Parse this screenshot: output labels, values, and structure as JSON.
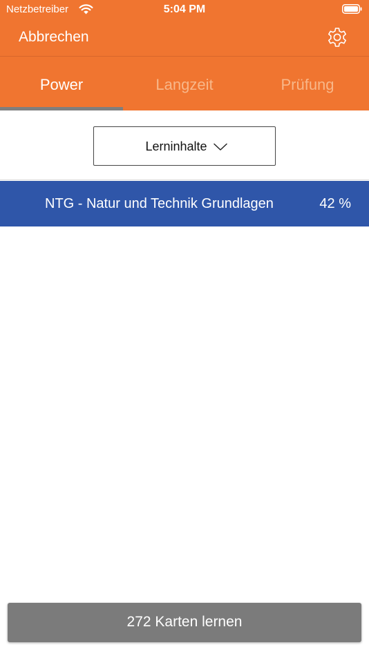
{
  "status_bar": {
    "carrier": "Netzbetreiber",
    "time": "5:04 PM",
    "wifi_icon": "wifi-icon",
    "battery_icon": "battery-icon"
  },
  "nav": {
    "cancel_label": "Abbrechen",
    "settings_icon": "gear-icon"
  },
  "tabs": [
    {
      "label": "Power",
      "active": true
    },
    {
      "label": "Langzeit",
      "active": false
    },
    {
      "label": "Prüfung",
      "active": false
    }
  ],
  "dropdown": {
    "selected": "Lerninhalte",
    "icon": "chevron-down-icon"
  },
  "topics": [
    {
      "title": "NTG - Natur und Technik Grundlagen",
      "percent_label": "42 %",
      "progress": 0.42
    }
  ],
  "learn_button": {
    "label": "272 Karten lernen"
  },
  "colors": {
    "header": "#f07530",
    "topic_row": "#2f56a9",
    "tab_indicator": "#7f7f7f",
    "learn_button": "#7b7b7b",
    "inactive_tab_text": "#f8b789"
  }
}
